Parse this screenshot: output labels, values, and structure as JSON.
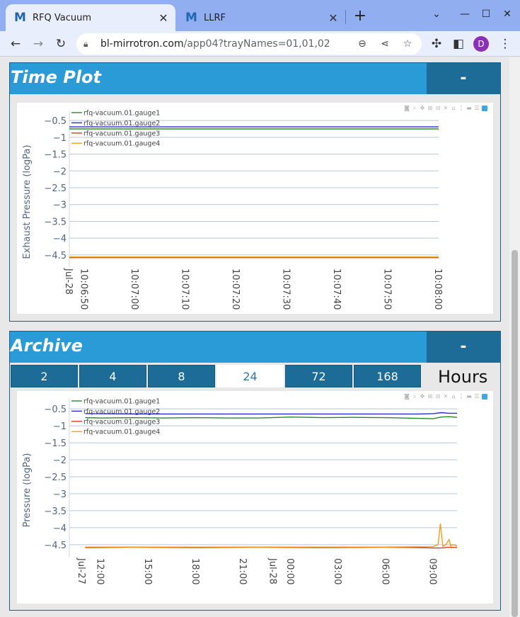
{
  "browser": {
    "tabs": [
      {
        "title": "RFQ Vacuum",
        "logo": "M",
        "active": true
      },
      {
        "title": "LLRF",
        "logo": "M",
        "active": false
      }
    ],
    "new_tab": "+",
    "url_host": "bl-mirrotron.com",
    "url_path": "/app04?trayNames=01,01,02",
    "profile_initial": "D",
    "colors": {
      "tabbar": "#90aef0",
      "toolbar": "#e9eefc",
      "avatar": "#8c2fb8"
    }
  },
  "panels": {
    "time_plot": {
      "title": "Time Plot",
      "collapse_label": "-"
    },
    "archive": {
      "title": "Archive",
      "collapse_label": "-",
      "hour_buttons": [
        "2",
        "4",
        "8",
        "24",
        "72",
        "168"
      ],
      "selected": "24",
      "hours_label": "Hours"
    }
  },
  "colors": {
    "header": "#2a9bd7",
    "button": "#1d6c98",
    "gauge1": "#2a8a2a",
    "gauge2": "#2b2bd6",
    "gauge3": "#e03a1a",
    "gauge4": "#f0a020"
  },
  "chart_data": [
    {
      "type": "line",
      "ylabel": "Exhaust Pressure (logPa)",
      "xlabel": "",
      "ylim": [
        -4.65,
        -0.35
      ],
      "yticks": [
        -0.5,
        -1,
        -1.5,
        -2,
        -2.5,
        -3,
        -3.5,
        -4,
        -4.5
      ],
      "ytick_labels": [
        "−0.5",
        "−1",
        "−1.5",
        "−2",
        "−2.5",
        "−3",
        "−3.5",
        "−4",
        "−4.5"
      ],
      "x_range_seconds": [
        0,
        73
      ],
      "xticks": [
        {
          "t": 0,
          "label": "Jul-28"
        },
        {
          "t": 3,
          "label": "10:06:50"
        },
        {
          "t": 13,
          "label": "10:07:00"
        },
        {
          "t": 23,
          "label": "10:07:10"
        },
        {
          "t": 33,
          "label": "10:07:20"
        },
        {
          "t": 43,
          "label": "10:07:30"
        },
        {
          "t": 53,
          "label": "10:07:40"
        },
        {
          "t": 63,
          "label": "10:07:50"
        },
        {
          "t": 73,
          "label": "10:08:00"
        }
      ],
      "legend_position": "top-left",
      "grid": true,
      "series": [
        {
          "name": "rfq-vacuum.01.gauge1",
          "color": "#2a8a2a",
          "x": [
            0,
            73
          ],
          "y": [
            -0.75,
            -0.75
          ]
        },
        {
          "name": "rfq-vacuum.01.gauge2",
          "color": "#2b2bd6",
          "x": [
            0,
            73
          ],
          "y": [
            -0.69,
            -0.69
          ]
        },
        {
          "name": "rfq-vacuum.01.gauge3",
          "color": "#e03a1a",
          "x": [
            0,
            73
          ],
          "y": [
            -4.58,
            -4.58
          ]
        },
        {
          "name": "rfq-vacuum.01.gauge4",
          "color": "#f0a020",
          "x": [
            0,
            73
          ],
          "y": [
            -4.56,
            -4.56
          ]
        }
      ]
    },
    {
      "type": "line",
      "ylabel": "Pressure (logPa)",
      "xlabel": "",
      "ylim": [
        -4.65,
        -0.35
      ],
      "yticks": [
        -0.5,
        -1,
        -1.5,
        -2,
        -2.5,
        -3,
        -3.5,
        -4,
        -4.5
      ],
      "ytick_labels": [
        "−0.5",
        "−1",
        "−1.5",
        "−2",
        "−2.5",
        "−3",
        "−3.5",
        "−4",
        "−4.5"
      ],
      "x_range_hours": [
        10,
        34.5
      ],
      "xticks": [
        {
          "t": 10.8,
          "label": "Jul-27"
        },
        {
          "t": 12,
          "label": "12:00"
        },
        {
          "t": 15,
          "label": "15:00"
        },
        {
          "t": 18,
          "label": "18:00"
        },
        {
          "t": 21,
          "label": "21:00"
        },
        {
          "t": 22.9,
          "label": "Jul-28"
        },
        {
          "t": 24,
          "label": "00:00"
        },
        {
          "t": 27,
          "label": "03:00"
        },
        {
          "t": 30,
          "label": "06:00"
        },
        {
          "t": 33,
          "label": "09:00"
        }
      ],
      "legend_position": "top-left",
      "grid": true,
      "series": [
        {
          "name": "rfq-vacuum.01.gauge1",
          "color": "#2a8a2a",
          "x": [
            11,
            12,
            14,
            16,
            18,
            20,
            22,
            24,
            26,
            28,
            30,
            32,
            33,
            33.5,
            34,
            34.5
          ],
          "y": [
            -0.76,
            -0.77,
            -0.76,
            -0.77,
            -0.76,
            -0.77,
            -0.77,
            -0.74,
            -0.76,
            -0.75,
            -0.76,
            -0.78,
            -0.79,
            -0.74,
            -0.73,
            -0.75
          ]
        },
        {
          "name": "rfq-vacuum.01.gauge2",
          "color": "#2b2bd6",
          "x": [
            11,
            14,
            18,
            22,
            24,
            28,
            32,
            33,
            33.5,
            34,
            34.5
          ],
          "y": [
            -0.64,
            -0.65,
            -0.65,
            -0.65,
            -0.65,
            -0.65,
            -0.65,
            -0.64,
            -0.61,
            -0.63,
            -0.63
          ]
        },
        {
          "name": "rfq-vacuum.01.gauge3",
          "color": "#e03a1a",
          "x": [
            11,
            14,
            18,
            22,
            26,
            30,
            32,
            33,
            33.5,
            34,
            34.5
          ],
          "y": [
            -4.59,
            -4.58,
            -4.59,
            -4.58,
            -4.59,
            -4.58,
            -4.59,
            -4.6,
            -4.6,
            -4.58,
            -4.59
          ]
        },
        {
          "name": "rfq-vacuum.01.gauge4",
          "color": "#f0a020",
          "x": [
            11,
            14,
            18,
            22,
            26,
            30,
            33,
            33.3,
            33.45,
            33.6,
            33.8,
            34,
            34.1,
            34.2,
            34.5
          ],
          "y": [
            -4.57,
            -4.57,
            -4.57,
            -4.57,
            -4.57,
            -4.57,
            -4.56,
            -4.5,
            -3.88,
            -4.55,
            -4.5,
            -4.35,
            -4.55,
            -4.5,
            -4.54
          ]
        }
      ]
    }
  ]
}
